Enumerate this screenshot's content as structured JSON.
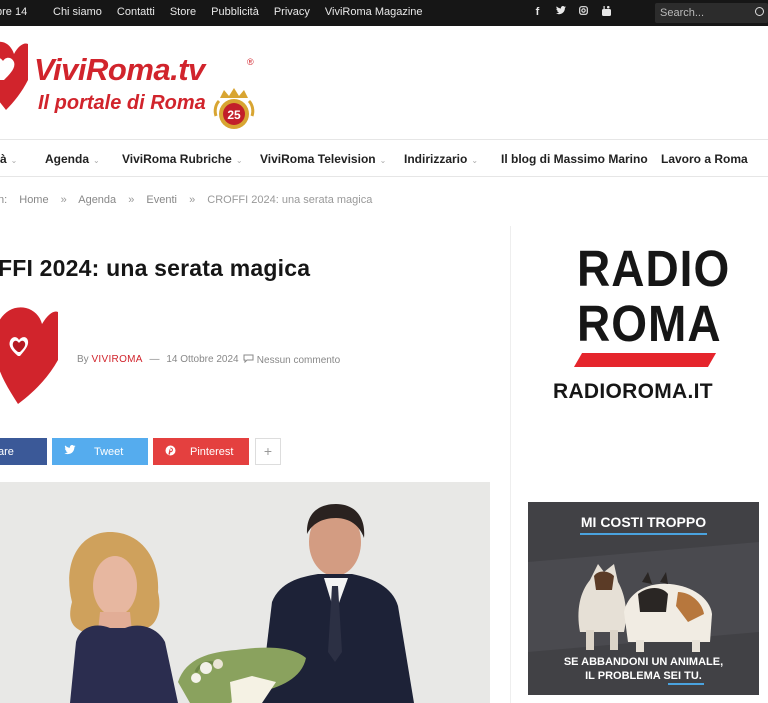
{
  "topbar": {
    "date": "bre 14",
    "links": [
      "Chi siamo",
      "Contatti",
      "Store",
      "Pubblicità",
      "Privacy",
      "ViviRoma Magazine"
    ],
    "social": [
      "facebook-icon",
      "twitter-icon",
      "instagram-icon",
      "youtube-icon"
    ],
    "search_placeholder": "Search..."
  },
  "logo": {
    "brand": "ViviRoma.tv",
    "reg": "®",
    "tagline": "Il portale di Roma",
    "badge": "25"
  },
  "nav": {
    "items": [
      {
        "label": "tà",
        "dropdown": true
      },
      {
        "label": "Agenda",
        "dropdown": true
      },
      {
        "label": "ViviRoma Rubriche",
        "dropdown": true
      },
      {
        "label": "ViviRoma Television",
        "dropdown": true
      },
      {
        "label": "Indirizzario",
        "dropdown": true
      },
      {
        "label": "Il blog di Massimo Marino",
        "dropdown": false
      },
      {
        "label": "Lavoro a Roma",
        "dropdown": false
      }
    ]
  },
  "breadcrumb": {
    "prefix": "n:",
    "items": [
      "Home",
      "Agenda",
      "Eventi"
    ],
    "current": "CROFFI 2024: una serata magica",
    "separator": "»"
  },
  "article": {
    "title": "FFI 2024: una serata magica",
    "by": "By",
    "author": "ViviRoma",
    "date": "14 Ottobre 2024",
    "comments": "Nessun commento"
  },
  "share": {
    "facebook": "are",
    "twitter": "Tweet",
    "pinterest": "Pinterest",
    "more": "+"
  },
  "sidebar": {
    "radio_line1": "RADIO",
    "radio_line2": "ROMA",
    "radio_site": "RADIOROMA.IT",
    "ad_headline": "MI COSTI TROPPO",
    "ad_line1": "SE ABBANDONI UN ANIMALE,",
    "ad_line2": "IL PROBLEMA SEI TU."
  },
  "colors": {
    "brand_red": "#d1242c",
    "topbar_bg": "#161616",
    "facebook": "#3b5998",
    "twitter": "#55acee",
    "pinterest": "#e4403f",
    "ad_accent": "#4aa3df"
  }
}
